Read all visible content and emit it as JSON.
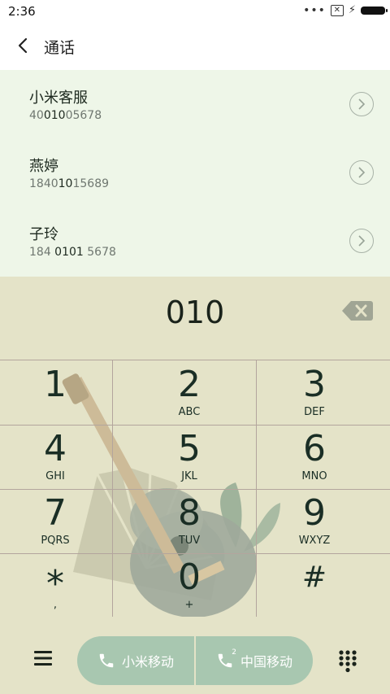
{
  "status_bar": {
    "time": "2:36"
  },
  "header": {
    "title": "通话"
  },
  "contacts": [
    {
      "name": "小米客服",
      "number_pre": "40",
      "number_match": "010",
      "number_post": "05678"
    },
    {
      "name": "燕婷",
      "number_pre": "1840",
      "number_match": "10",
      "number_post": "15689"
    },
    {
      "name": "子玲",
      "number_pre": "184 ",
      "number_match": "0101",
      "number_post": " 5678"
    }
  ],
  "dialer": {
    "dialed_number": "010"
  },
  "keys": [
    {
      "digit": "1",
      "letters": ""
    },
    {
      "digit": "2",
      "letters": "ABC"
    },
    {
      "digit": "3",
      "letters": "DEF"
    },
    {
      "digit": "4",
      "letters": "GHI"
    },
    {
      "digit": "5",
      "letters": "JKL"
    },
    {
      "digit": "6",
      "letters": "MNO"
    },
    {
      "digit": "7",
      "letters": "PQRS"
    },
    {
      "digit": "8",
      "letters": "TUV"
    },
    {
      "digit": "9",
      "letters": "WXYZ"
    },
    {
      "digit": "*",
      "letters": ","
    },
    {
      "digit": "0",
      "letters": "+"
    },
    {
      "digit": "#",
      "letters": ""
    }
  ],
  "bottom_bar": {
    "sim1_label": "小米移动",
    "sim1_badge": "",
    "sim2_label": "中国移动",
    "sim2_badge": "2"
  },
  "colors": {
    "accent": "#a8c7b0",
    "contacts_bg": "#eef6e8",
    "keypad_bg": "#e4e3c8",
    "digit": "#1a2e25"
  }
}
